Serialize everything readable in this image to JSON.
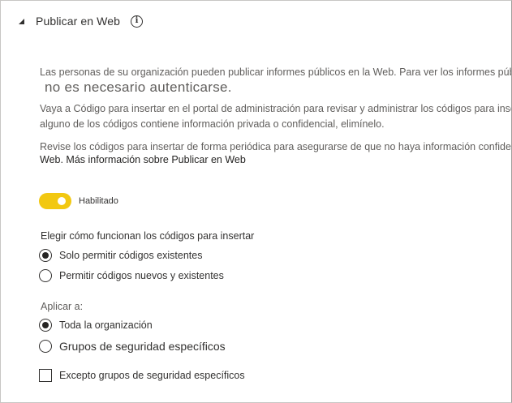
{
  "header": {
    "title": "Publicar en Web",
    "info_icon": "i"
  },
  "description": {
    "line1": "Las personas de su organización pueden publicar informes públicos en la Web. Para ver los informes públ",
    "line2": "no es necesario autenticarse.",
    "line3": "Vaya a Código para insertar en el portal de administración para revisar y administrar los códigos para inse",
    "line4": "alguno de los códigos contiene información privada o confidencial, elimínelo.",
    "line5": "Revise los códigos para insertar de forma periódica para asegurarse de que no haya información confiden",
    "line6": "Web. Más información sobre Publicar en Web"
  },
  "toggle": {
    "label": "Habilitado",
    "on": true,
    "color": "#f2c811"
  },
  "embed_codes": {
    "label": "Elegir cómo funcionan los códigos para insertar",
    "options": [
      {
        "label": "Solo permitir códigos existentes",
        "checked": true
      },
      {
        "label": "Permitir códigos nuevos y existentes",
        "checked": false
      }
    ]
  },
  "apply_to": {
    "label": "Aplicar a:",
    "options": [
      {
        "label": "Toda la organización",
        "checked": true
      },
      {
        "label": "Grupos de seguridad específicos",
        "checked": false
      }
    ],
    "except_checkbox": {
      "label": "Excepto grupos de seguridad específicos",
      "checked": false
    }
  }
}
